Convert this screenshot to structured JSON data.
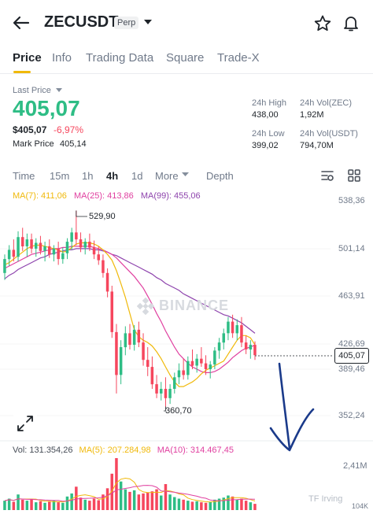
{
  "header": {
    "symbol": "ZECUSDT",
    "contract_type": "Perp"
  },
  "tabs": [
    {
      "label": "Price",
      "active": true
    },
    {
      "label": "Info",
      "active": false
    },
    {
      "label": "Trading Data",
      "active": false
    },
    {
      "label": "Square",
      "active": false
    },
    {
      "label": "Trade-X",
      "active": false
    }
  ],
  "ticker": {
    "last_price_label": "Last Price",
    "last_price": "405,07",
    "fiat_price": "$405,07",
    "change_pct": "-6,97%",
    "mark_price_label": "Mark Price",
    "mark_price": "405,14"
  },
  "stats": {
    "high_label": "24h High",
    "high_value": "438,00",
    "vol_zec_label": "24h Vol(ZEC)",
    "vol_zec_value": "1,92M",
    "low_label": "24h Low",
    "low_value": "399,02",
    "vol_usdt_label": "24h Vol(USDT)",
    "vol_usdt_value": "794,70M"
  },
  "intervals": [
    {
      "label": "Time",
      "active": false
    },
    {
      "label": "15m",
      "active": false
    },
    {
      "label": "1h",
      "active": false
    },
    {
      "label": "4h",
      "active": true
    },
    {
      "label": "1d",
      "active": false
    },
    {
      "label": "More",
      "active": false
    },
    {
      "label": "Depth",
      "active": false
    }
  ],
  "indicators": {
    "ma7": "MA(7): 411,06",
    "ma25": "MA(25): 413,86",
    "ma99": "MA(99): 455,06"
  },
  "volume_indicators": {
    "vol": "Vol: 131.354,26",
    "ma5": "MA(5): 207.284,98",
    "ma10": "MA(10): 314.467,45"
  },
  "watermark": "BINANCE",
  "credit": "TF Irving",
  "colors": {
    "up": "#2ebd85",
    "down": "#f6465d",
    "ma7": "#f0b90b",
    "ma25": "#e040a0",
    "ma99": "#8e44ad",
    "accent": "#f0b90b",
    "annotation_arrow": "#1a3a8a"
  },
  "chart_data": {
    "type": "candlestick",
    "interval": "4h",
    "y_axis_ticks": [
      "538,36",
      "501,14",
      "463,91",
      "426,69",
      "389,46",
      "352,24"
    ],
    "ylim": [
      352.24,
      538.36
    ],
    "volume_axis_ticks": [
      "2,41M",
      "104K"
    ],
    "current_price": "405,07",
    "period_high": "529,90",
    "period_low": "360,70",
    "candles": [
      {
        "o": 476,
        "h": 492,
        "l": 470,
        "c": 488
      },
      {
        "o": 488,
        "h": 500,
        "l": 482,
        "c": 496
      },
      {
        "o": 496,
        "h": 505,
        "l": 486,
        "c": 490
      },
      {
        "o": 490,
        "h": 512,
        "l": 486,
        "c": 507
      },
      {
        "o": 507,
        "h": 515,
        "l": 495,
        "c": 499
      },
      {
        "o": 499,
        "h": 510,
        "l": 490,
        "c": 505
      },
      {
        "o": 505,
        "h": 510,
        "l": 493,
        "c": 497
      },
      {
        "o": 497,
        "h": 506,
        "l": 490,
        "c": 502
      },
      {
        "o": 502,
        "h": 508,
        "l": 492,
        "c": 495
      },
      {
        "o": 495,
        "h": 503,
        "l": 486,
        "c": 499
      },
      {
        "o": 499,
        "h": 505,
        "l": 489,
        "c": 492
      },
      {
        "o": 492,
        "h": 500,
        "l": 486,
        "c": 497
      },
      {
        "o": 497,
        "h": 503,
        "l": 483,
        "c": 488
      },
      {
        "o": 488,
        "h": 498,
        "l": 484,
        "c": 493
      },
      {
        "o": 493,
        "h": 506,
        "l": 488,
        "c": 503
      },
      {
        "o": 503,
        "h": 515,
        "l": 496,
        "c": 511
      },
      {
        "o": 511,
        "h": 529.9,
        "l": 500,
        "c": 505
      },
      {
        "o": 505,
        "h": 511,
        "l": 494,
        "c": 498
      },
      {
        "o": 498,
        "h": 506,
        "l": 492,
        "c": 503
      },
      {
        "o": 503,
        "h": 510,
        "l": 495,
        "c": 498
      },
      {
        "o": 498,
        "h": 504,
        "l": 488,
        "c": 492
      },
      {
        "o": 492,
        "h": 499,
        "l": 483,
        "c": 487
      },
      {
        "o": 487,
        "h": 492,
        "l": 472,
        "c": 476
      },
      {
        "o": 476,
        "h": 480,
        "l": 455,
        "c": 460
      },
      {
        "o": 460,
        "h": 465,
        "l": 420,
        "c": 425
      },
      {
        "o": 425,
        "h": 432,
        "l": 372,
        "c": 388
      },
      {
        "o": 388,
        "h": 418,
        "l": 380,
        "c": 412
      },
      {
        "o": 412,
        "h": 430,
        "l": 405,
        "c": 424
      },
      {
        "o": 424,
        "h": 432,
        "l": 410,
        "c": 414
      },
      {
        "o": 414,
        "h": 431,
        "l": 409,
        "c": 427
      },
      {
        "o": 427,
        "h": 434,
        "l": 412,
        "c": 416
      },
      {
        "o": 416,
        "h": 424,
        "l": 396,
        "c": 401
      },
      {
        "o": 401,
        "h": 412,
        "l": 387,
        "c": 395
      },
      {
        "o": 395,
        "h": 404,
        "l": 376,
        "c": 380
      },
      {
        "o": 380,
        "h": 388,
        "l": 368,
        "c": 372
      },
      {
        "o": 372,
        "h": 382,
        "l": 366,
        "c": 376
      },
      {
        "o": 376,
        "h": 386,
        "l": 360.7,
        "c": 368
      },
      {
        "o": 368,
        "h": 380,
        "l": 363,
        "c": 376
      },
      {
        "o": 376,
        "h": 390,
        "l": 372,
        "c": 386
      },
      {
        "o": 386,
        "h": 398,
        "l": 380,
        "c": 392
      },
      {
        "o": 392,
        "h": 402,
        "l": 384,
        "c": 388
      },
      {
        "o": 388,
        "h": 404,
        "l": 384,
        "c": 400
      },
      {
        "o": 400,
        "h": 410,
        "l": 393,
        "c": 396
      },
      {
        "o": 396,
        "h": 406,
        "l": 390,
        "c": 402
      },
      {
        "o": 402,
        "h": 412,
        "l": 395,
        "c": 398
      },
      {
        "o": 398,
        "h": 405,
        "l": 388,
        "c": 393
      },
      {
        "o": 393,
        "h": 400,
        "l": 385,
        "c": 397
      },
      {
        "o": 397,
        "h": 412,
        "l": 393,
        "c": 409
      },
      {
        "o": 409,
        "h": 420,
        "l": 402,
        "c": 416
      },
      {
        "o": 416,
        "h": 428,
        "l": 410,
        "c": 424
      },
      {
        "o": 424,
        "h": 438,
        "l": 418,
        "c": 434
      },
      {
        "o": 434,
        "h": 440,
        "l": 420,
        "c": 424
      },
      {
        "o": 424,
        "h": 436,
        "l": 418,
        "c": 431
      },
      {
        "o": 431,
        "h": 438,
        "l": 412,
        "c": 416
      },
      {
        "o": 416,
        "h": 422,
        "l": 406,
        "c": 410
      },
      {
        "o": 410,
        "h": 418,
        "l": 402,
        "c": 414
      },
      {
        "o": 414,
        "h": 417,
        "l": 401,
        "c": 405.07
      }
    ],
    "ma7": [
      483,
      485,
      488,
      491,
      494,
      497,
      499,
      500,
      500,
      499,
      498,
      497,
      496,
      494,
      495,
      498,
      501,
      502,
      502,
      502,
      501,
      499,
      496,
      492,
      487,
      478,
      467,
      455,
      441,
      427,
      421,
      418,
      416,
      413,
      408,
      402,
      395,
      388,
      382,
      378,
      378,
      380,
      382,
      385,
      389,
      392,
      394,
      396,
      398,
      400,
      406,
      412,
      418,
      422,
      422,
      420,
      414
    ],
    "ma25": [
      480,
      482,
      484,
      486,
      488,
      490,
      492,
      493,
      494,
      495,
      496,
      497,
      497,
      498,
      498,
      499,
      499,
      499,
      499,
      499,
      498,
      497,
      496,
      494,
      492,
      489,
      485,
      481,
      477,
      473,
      468,
      463,
      456,
      449,
      441,
      434,
      426,
      419,
      412,
      406,
      402,
      398,
      395,
      393,
      391,
      390,
      390,
      391,
      393,
      396,
      399,
      403,
      406,
      409,
      411,
      412,
      414
    ],
    "ma99": [
      471,
      474,
      476,
      479,
      481,
      483,
      485,
      487,
      489,
      490,
      492,
      493,
      494,
      495,
      496,
      496,
      497,
      497,
      497,
      497,
      496,
      496,
      495,
      494,
      492,
      491,
      489,
      487,
      485,
      483,
      481,
      479,
      477,
      475,
      472,
      470,
      467,
      465,
      463,
      461,
      458,
      456,
      454,
      452,
      450,
      448,
      446,
      444,
      442,
      440,
      439,
      437,
      435,
      433,
      430,
      427,
      424
    ],
    "volumes": [
      0.18,
      0.22,
      0.16,
      0.3,
      0.2,
      0.18,
      0.22,
      0.15,
      0.17,
      0.14,
      0.16,
      0.18,
      0.15,
      0.14,
      0.26,
      0.32,
      0.45,
      0.24,
      0.2,
      0.18,
      0.22,
      0.19,
      0.3,
      0.42,
      0.7,
      1.0,
      0.55,
      0.4,
      0.35,
      0.38,
      0.3,
      0.32,
      0.34,
      0.36,
      0.4,
      0.28,
      0.5,
      0.3,
      0.25,
      0.22,
      0.2,
      0.18,
      0.16,
      0.17,
      0.15,
      0.14,
      0.16,
      0.2,
      0.22,
      0.24,
      0.28,
      0.26,
      0.2,
      0.22,
      0.18,
      0.15,
      0.12
    ]
  }
}
